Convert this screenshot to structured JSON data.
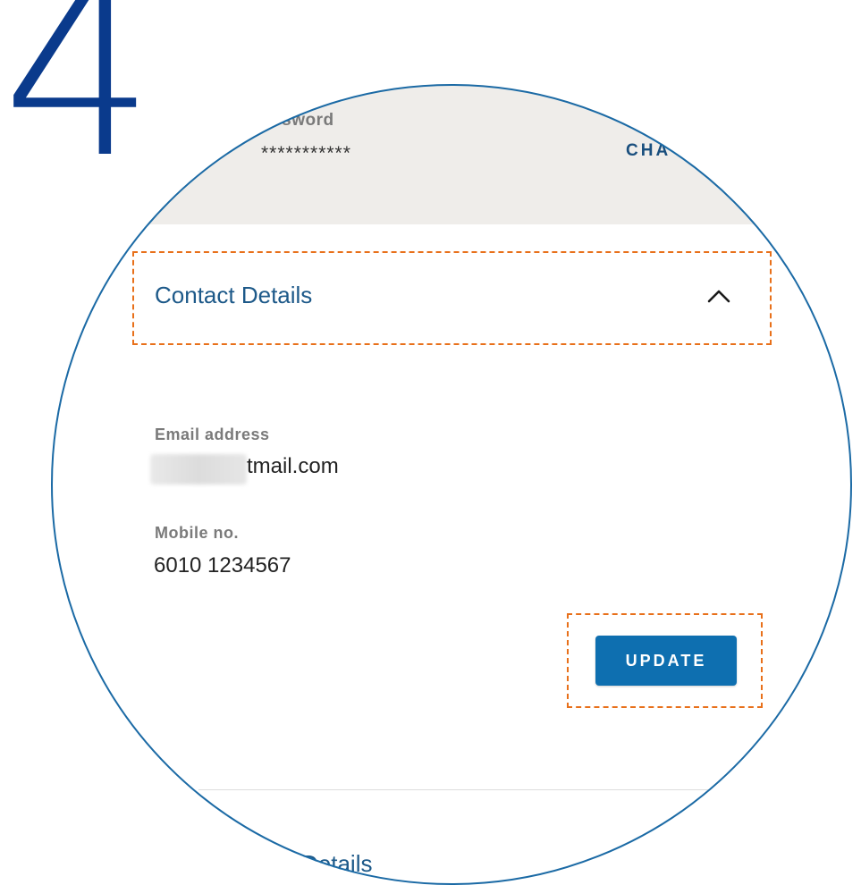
{
  "step_number": "4",
  "account": {
    "password_label": "assword",
    "password_value": "***********",
    "change_label": "CHA"
  },
  "contact_details": {
    "title": "Contact Details",
    "toggle_icon": "chevron-up-icon",
    "email_label": "Email address",
    "email_value": "tmail.com",
    "mobile_label": "Mobile no.",
    "mobile_value": "6010 1234567",
    "update_label": "UPDATE"
  },
  "next_section": {
    "title": "Details"
  },
  "colors": {
    "step_number": "#0a3a8c",
    "lens_border": "#1b6aa5",
    "highlight": "#e8701a",
    "button": "#0e6fb0",
    "section_title": "#1d5989",
    "panel_background": "#efedea"
  }
}
